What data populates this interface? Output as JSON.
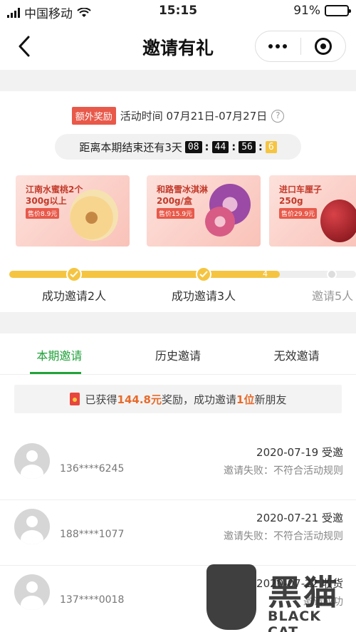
{
  "status_bar": {
    "carrier": "中国移动",
    "time": "15:15",
    "battery": "91%",
    "battery_level": 0.91
  },
  "nav": {
    "title": "邀请有礼"
  },
  "activity": {
    "badge": "额外奖励",
    "time_label": "活动时间 07月21日-07月27日",
    "help": "?",
    "countdown_label": "距离本期结束还有3天",
    "countdown": [
      "08",
      "44",
      "56",
      "6"
    ]
  },
  "prizes": [
    {
      "name_line1": "江南水蜜桃2个",
      "name_line2": "300g以上",
      "price": "售价8.9元"
    },
    {
      "name_line1": "和路雪冰淇淋",
      "name_line2": "200g/盒",
      "price": "售价15.9元"
    },
    {
      "name_line1": "进口车厘子",
      "name_line2": "250g",
      "price": "售价29.9元"
    }
  ],
  "progress": {
    "fraction": 0.78,
    "node_number": "4",
    "steps": [
      "成功邀请2人",
      "成功邀请3人",
      "邀请5人"
    ]
  },
  "tabs": [
    {
      "label": "本期邀请",
      "active": true
    },
    {
      "label": "历史邀请",
      "active": false
    },
    {
      "label": "无效邀请",
      "active": false
    }
  ],
  "summary": {
    "prefix": "已获得",
    "amount": "144.8元",
    "middle": "奖励，成功邀请",
    "count": "1位",
    "suffix": "新朋友"
  },
  "invites": [
    {
      "phone": "136****6245",
      "date": "2020-07-19 受邀",
      "reason": "邀请失败：不符合活动规则"
    },
    {
      "phone": "188****1077",
      "date": "2020-07-21 受邀",
      "reason": "邀请失败：不符合活动规则"
    },
    {
      "phone": "137****0018",
      "date": "2020-07-22 收货",
      "reason": "邀请成功"
    }
  ],
  "watermark": {
    "cn": "黑猫",
    "en": "BLACK CAT"
  },
  "colors": {
    "accent_green": "#22a23b",
    "badge_red": "#e8594a",
    "progress_yellow": "#f5c542",
    "highlight_orange": "#e86a2a"
  }
}
